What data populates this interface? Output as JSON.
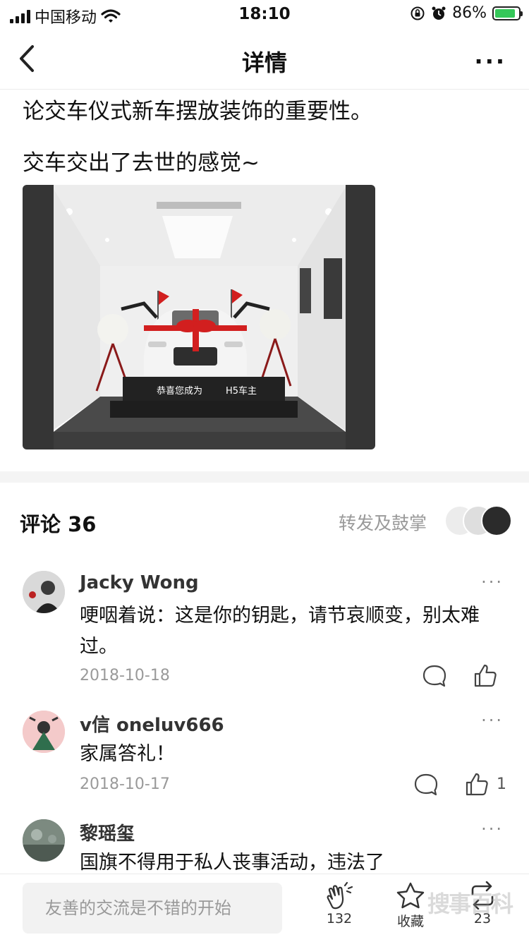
{
  "status_bar": {
    "carrier": "中国移动",
    "time": "18:10",
    "battery_percent": "86%",
    "battery_level": 0.86,
    "icons": [
      "signal-icon",
      "wifi-icon",
      "orientation-lock-icon",
      "alarm-icon",
      "battery-charging-icon"
    ]
  },
  "nav": {
    "title": "详情",
    "more": "···"
  },
  "post": {
    "line1": "论交车仪式新车摆放装饰的重要性。",
    "line2": "交车交出了去世的感觉~",
    "photo_banner": "恭喜您成为",
    "photo_banner_model": "H5车主"
  },
  "comments_header": {
    "title": "评论 36",
    "share_label": "转发及鼓掌"
  },
  "comments": [
    {
      "name": "Jacky Wong",
      "text": "哽咽着说：这是你的钥匙，请节哀顺变，别太难过。",
      "date": "2018-10-18",
      "likes": ""
    },
    {
      "name": "v信 oneluv666",
      "text": "家属答礼！",
      "date": "2018-10-17",
      "likes": "1"
    },
    {
      "name": "黎瑶玺",
      "text": "国旗不得用于私人丧事活动，违法了",
      "date": "",
      "likes": ""
    }
  ],
  "bottom_bar": {
    "input_placeholder": "友善的交流是不错的开始",
    "clap_count": "132",
    "favorite_label": "收藏",
    "repost_count": "23",
    "watermark": "搜事百科"
  },
  "colors": {
    "accent_green": "#35c759",
    "flag_red": "#d21f1f",
    "muted_text": "#9a9a9a"
  }
}
